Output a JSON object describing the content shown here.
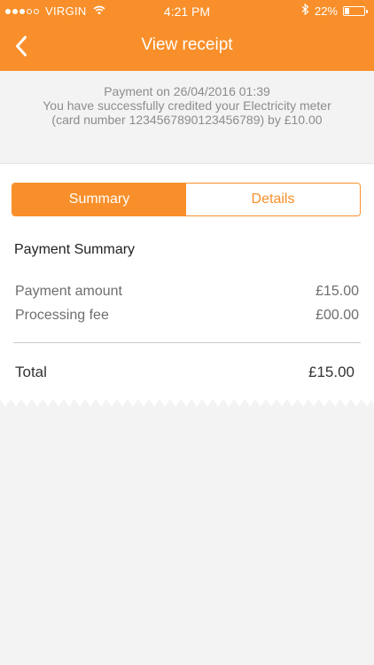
{
  "status_bar": {
    "carrier": "VIRGIN",
    "time": "4:21 PM",
    "battery_percent": "22%",
    "battery_level": 0.22,
    "signal_bars_filled": 3,
    "signal_bars_total": 5
  },
  "nav": {
    "title": "View receipt",
    "back_icon": "chevron-left-icon"
  },
  "notice": {
    "line1": "Payment on 26/04/2016 01:39",
    "line2": "You have successfully credited your Electricity meter",
    "line3": "(card number 1234567890123456789) by £10.00"
  },
  "tabs": {
    "summary": "Summary",
    "details": "Details",
    "selected": "Summary"
  },
  "summary": {
    "title": "Payment Summary",
    "payment_amount_label": "Payment amount",
    "payment_amount_value": "£15.00",
    "processing_fee_label": "Processing fee",
    "processing_fee_value": "£00.00",
    "total_label": "Total",
    "total_value": "£15.00"
  },
  "colors": {
    "accent": "#f98f2a",
    "background": "#f3f3f3",
    "card": "#ffffff"
  }
}
